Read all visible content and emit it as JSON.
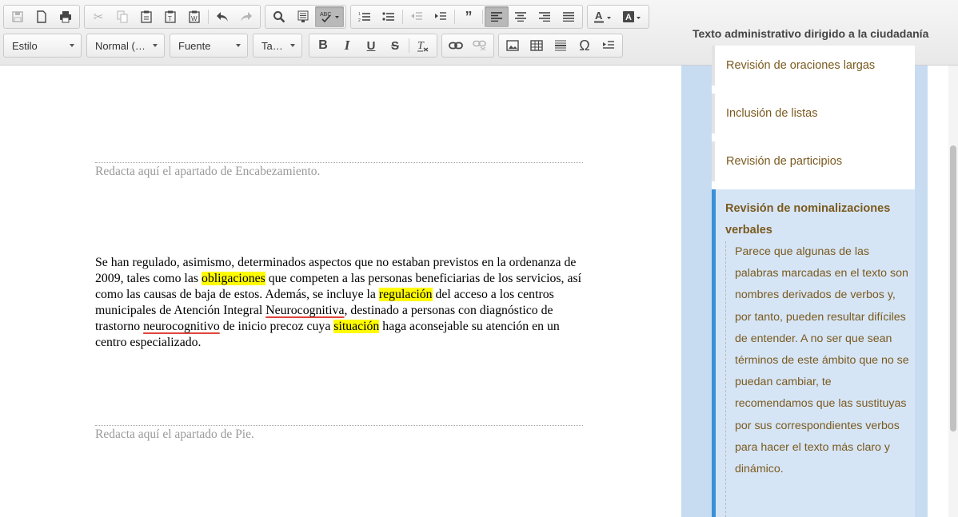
{
  "toolbar": {
    "style_label": "Estilo",
    "format_label": "Normal (…",
    "font_label": "Fuente",
    "size_label": "Ta…"
  },
  "header": {
    "title": "Texto administrativo dirigido a la ciudadanía"
  },
  "editor": {
    "header_placeholder": "Redacta aquí el apartado de Encabezamiento.",
    "footer_placeholder": "Redacta aquí el apartado de Pie.",
    "body": {
      "s1": "Se han regulado, asimismo, determinados aspectos que no estaban previstos en la ordenanza de 2009, tales como las ",
      "h1": "obligaciones",
      "s2": " que competen a las personas beneficiarias de los servicios, así como las causas de baja de estos. Además, se incluye la ",
      "h2": "regulación",
      "s3": " del acceso a los centros municipales de Atención Integral ",
      "u1": "Neurocognitiva",
      "s4": ", destinado a personas con diagnóstico de trastorno ",
      "u2": "neurocognitivo",
      "s5": " de inicio precoz cuya ",
      "h3": "situación",
      "s6": " haga aconsejable su atención en un centro especializado."
    }
  },
  "sidebar": {
    "items": [
      {
        "label": "Revisión de oraciones largas"
      },
      {
        "label": "Inclusión de listas"
      },
      {
        "label": "Revisión de participios"
      }
    ],
    "expanded": {
      "title": "Revisión de nominalizaciones verbales",
      "body": "Parece que algunas de las palabras marcadas en el texto son nombres derivados de verbos y, por tanto, pueden resultar difíciles de entender. A no ser que sean términos de este ámbito que no se puedan cambiar, te recomendamos que las sustituyas por sus correspondientes verbos para hacer el texto más claro y dinámico."
    }
  },
  "colors": {
    "highlight": "#fffb00",
    "spellcheck_underline": "#e0453b",
    "sidebar_accent": "#3a8fd6",
    "sidebar_text": "#7a5a1e"
  },
  "icons": [
    "save-icon",
    "new-page-icon",
    "print-icon",
    "cut-icon",
    "copy-icon",
    "paste-icon",
    "paste-text-icon",
    "paste-word-icon",
    "undo-icon",
    "redo-icon",
    "search-icon",
    "templates-icon",
    "spellcheck-icon",
    "numbered-list-icon",
    "bulleted-list-icon",
    "outdent-icon",
    "indent-icon",
    "blockquote-icon",
    "align-left-icon",
    "align-center-icon",
    "align-right-icon",
    "justify-icon",
    "text-color-icon",
    "background-color-icon",
    "bold-icon",
    "italic-icon",
    "underline-icon",
    "strikethrough-icon",
    "remove-format-icon",
    "link-icon",
    "unlink-icon",
    "image-icon",
    "table-icon",
    "horizontal-rule-icon",
    "special-char-icon",
    "outdent-block-icon"
  ]
}
